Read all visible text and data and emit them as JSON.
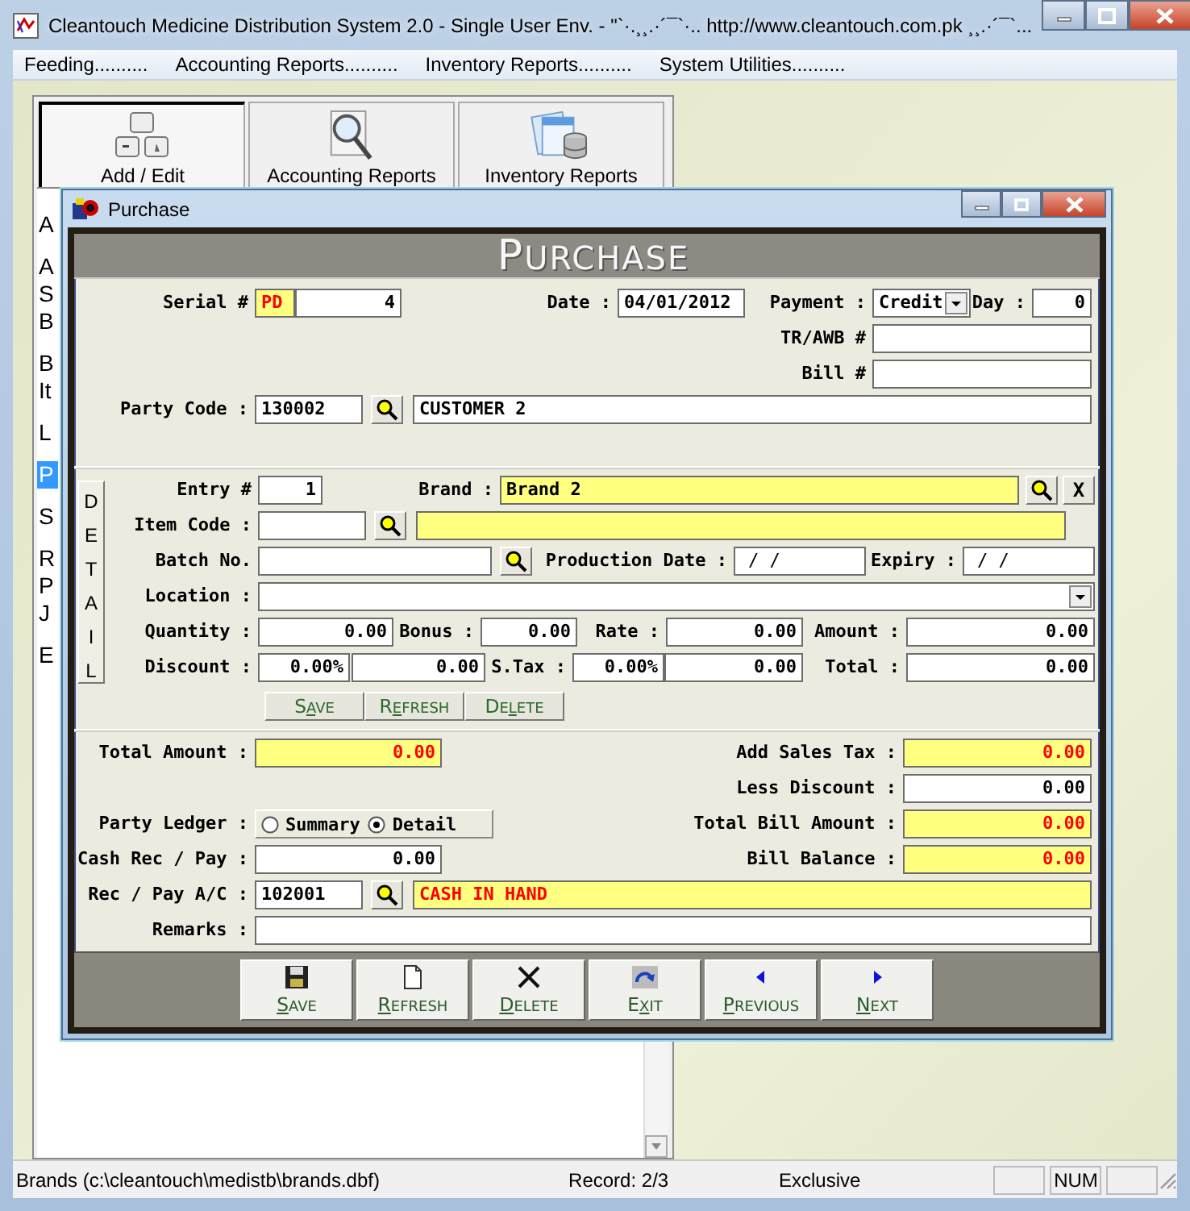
{
  "window": {
    "title": "Cleantouch Medicine Distribution System 2.0 - Single User Env.  -  \"`·.¸¸.·´¯`·.. http://www.cleantouch.com.pk ¸¸.·´¯`..."
  },
  "menu": [
    {
      "label": "Feeding.........."
    },
    {
      "label": "Accounting Reports.........."
    },
    {
      "label": "Inventory Reports.........."
    },
    {
      "label": "System Utilities.........."
    }
  ],
  "module_tabs": [
    {
      "label": "Add / Edit",
      "kind": "keys",
      "selected": true
    },
    {
      "label": "Accounting Reports",
      "kind": "search",
      "selected": false
    },
    {
      "label": "Inventory Reports",
      "kind": "database",
      "selected": false
    }
  ],
  "module_list": [
    {
      "lines": [
        "A"
      ],
      "selected": false
    },
    {
      "lines": [
        "A",
        "S",
        "B"
      ],
      "selected": false
    },
    {
      "lines": [
        "B",
        "It"
      ],
      "selected": false
    },
    {
      "lines": [
        "L"
      ],
      "selected": false
    },
    {
      "lines": [
        "P"
      ],
      "selected": true
    },
    {
      "lines": [
        "S"
      ],
      "selected": false
    },
    {
      "lines": [
        "R",
        "P",
        "J"
      ],
      "selected": false
    },
    {
      "lines": [
        "E"
      ],
      "selected": false
    }
  ],
  "dialog": {
    "title": "Purchase",
    "heading": "PURCHASE",
    "header": {
      "serial": {
        "label": "Serial #",
        "prefix": "PD",
        "value": "4"
      },
      "date": {
        "label": "Date :",
        "value": "04/01/2012"
      },
      "payment": {
        "label": "Payment :",
        "value": "Credit"
      },
      "day": {
        "label": "Day :",
        "value": "0"
      },
      "tr_awb": {
        "label": "TR/AWB #"
      },
      "bill": {
        "label": "Bill #"
      },
      "party_code": {
        "label": "Party Code :",
        "value": "130002",
        "name": "CUSTOMER 2"
      }
    },
    "detail": {
      "tab_label": "DETAIL",
      "entry": {
        "label": "Entry #",
        "value": "1"
      },
      "brand": {
        "label": "Brand :",
        "value": "Brand 2"
      },
      "clear_button": "X",
      "item_code": {
        "label": "Item Code :"
      },
      "batch": {
        "label": "Batch No."
      },
      "production_date": {
        "label": "Production Date :",
        "value": "/ /"
      },
      "expiry": {
        "label": "Expiry :",
        "value": "/ /"
      },
      "location": {
        "label": "Location :"
      },
      "quantity": {
        "label": "Quantity :",
        "value": "0.00"
      },
      "bonus": {
        "label": "Bonus :",
        "value": "0.00"
      },
      "rate": {
        "label": "Rate :",
        "value": "0.00"
      },
      "amount": {
        "label": "Amount :",
        "value": "0.00"
      },
      "discount": {
        "label": "Discount :",
        "percent": "0.00%",
        "value": "0.00"
      },
      "stax": {
        "label": "S.Tax :",
        "percent": "0.00%",
        "value": "0.00"
      },
      "total": {
        "label": "Total :",
        "value": "0.00"
      },
      "buttons": [
        {
          "label": {
            "before": "S",
            "key": "A",
            "after": "VE"
          }
        },
        {
          "label": {
            "before": "R",
            "key": "E",
            "after": "FRESH"
          }
        },
        {
          "label": {
            "before": "DE",
            "key": "L",
            "after": "ETE"
          }
        }
      ]
    },
    "summary": {
      "total_amount": {
        "label": "Total Amount :",
        "value": "0.00"
      },
      "add_sales_tax": {
        "label": "Add Sales Tax :",
        "value": "0.00"
      },
      "less_discount": {
        "label": "Less Discount :",
        "value": "0.00"
      },
      "party_ledger": {
        "label": "Party Ledger :",
        "options": [
          {
            "label": "Summary",
            "selected": false
          },
          {
            "label": "Detail",
            "selected": true
          }
        ]
      },
      "total_bill_amount": {
        "label": "Total Bill Amount :",
        "value": "0.00"
      },
      "cash_rec_pay": {
        "label": "Cash Rec / Pay :",
        "value": "0.00"
      },
      "bill_balance": {
        "label": "Bill Balance :",
        "value": "0.00"
      },
      "rec_pay_ac": {
        "label": "Rec / Pay A/C :",
        "value": "102001",
        "name": "CASH IN HAND"
      },
      "remarks": {
        "label": "Remarks :"
      }
    },
    "toolbar": [
      {
        "label": {
          "key": "S",
          "after": "AVE"
        },
        "kind": "save"
      },
      {
        "label": {
          "key": "R",
          "after": "EFRESH"
        },
        "kind": "refresh"
      },
      {
        "label": {
          "key": "D",
          "after": "ELETE"
        },
        "kind": "delete"
      },
      {
        "label": {
          "before": "E",
          "key": "X",
          "after": "IT"
        },
        "kind": "exit"
      },
      {
        "label": {
          "key": "P",
          "after": "REVIOUS"
        },
        "kind": "previous"
      },
      {
        "label": {
          "key": "N",
          "after": "EXT"
        },
        "kind": "next"
      }
    ]
  },
  "status_bar": {
    "file": "Brands (c:\\cleantouch\\medistb\\brands.dbf)",
    "record": "Record: 2/3",
    "mode": "Exclusive",
    "indicator": "NUM"
  }
}
